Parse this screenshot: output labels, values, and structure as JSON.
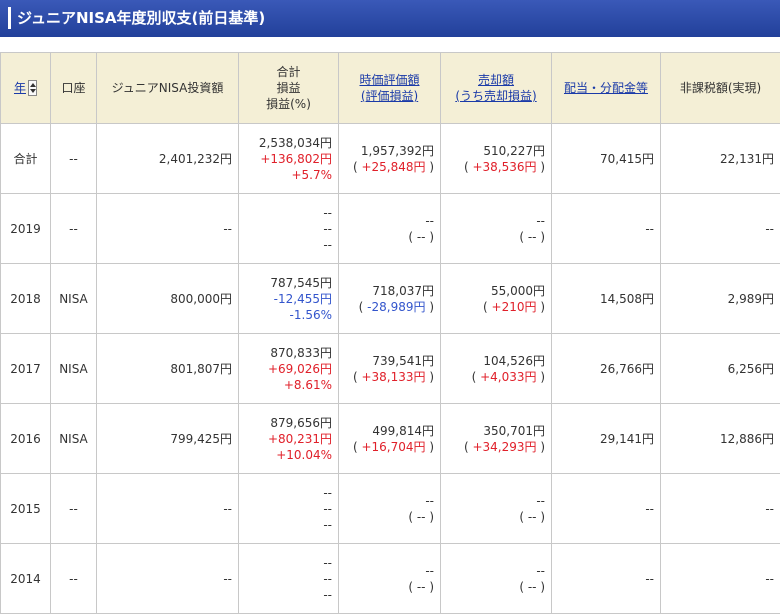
{
  "title": "ジュニアNISA年度別収支(前日基準)",
  "headers": {
    "year": "年",
    "account": "口座",
    "invest": "ジュニアNISA投資額",
    "total_l1": "合計",
    "total_l2": "損益",
    "total_l3": "損益(%)",
    "eval_l1": "時価評価額",
    "eval_l2": "(評価損益)",
    "sale_l1": "売却額",
    "sale_l2": "(うち売却損益)",
    "dividend": "配当・分配金等",
    "tax": "非課税額(実現)"
  },
  "rows": [
    {
      "year": "合計",
      "account": "--",
      "invest": "2,401,232円",
      "total": "2,538,034円",
      "pl": "+136,802円",
      "pct": "+5.7%",
      "eval": "1,957,392円",
      "eval_pl": "+25,848円",
      "sale": "510,227円",
      "sale_pl": "+38,536円",
      "dividend": "70,415円",
      "tax": "22,131円",
      "pl_sign": "pos",
      "eval_sign": "pos",
      "sale_sign": "pos"
    },
    {
      "year": "2019",
      "account": "--",
      "invest": "--",
      "total": "--",
      "pl": "--",
      "pct": "--",
      "eval": "--",
      "eval_pl": "--",
      "sale": "--",
      "sale_pl": "--",
      "dividend": "--",
      "tax": "--",
      "pl_sign": "none",
      "eval_sign": "none",
      "sale_sign": "none"
    },
    {
      "year": "2018",
      "account": "NISA",
      "invest": "800,000円",
      "total": "787,545円",
      "pl": "-12,455円",
      "pct": "-1.56%",
      "eval": "718,037円",
      "eval_pl": "-28,989円",
      "sale": "55,000円",
      "sale_pl": "+210円",
      "dividend": "14,508円",
      "tax": "2,989円",
      "pl_sign": "neg",
      "eval_sign": "neg",
      "sale_sign": "pos"
    },
    {
      "year": "2017",
      "account": "NISA",
      "invest": "801,807円",
      "total": "870,833円",
      "pl": "+69,026円",
      "pct": "+8.61%",
      "eval": "739,541円",
      "eval_pl": "+38,133円",
      "sale": "104,526円",
      "sale_pl": "+4,033円",
      "dividend": "26,766円",
      "tax": "6,256円",
      "pl_sign": "pos",
      "eval_sign": "pos",
      "sale_sign": "pos"
    },
    {
      "year": "2016",
      "account": "NISA",
      "invest": "799,425円",
      "total": "879,656円",
      "pl": "+80,231円",
      "pct": "+10.04%",
      "eval": "499,814円",
      "eval_pl": "+16,704円",
      "sale": "350,701円",
      "sale_pl": "+34,293円",
      "dividend": "29,141円",
      "tax": "12,886円",
      "pl_sign": "pos",
      "eval_sign": "pos",
      "sale_sign": "pos"
    },
    {
      "year": "2015",
      "account": "--",
      "invest": "--",
      "total": "--",
      "pl": "--",
      "pct": "--",
      "eval": "--",
      "eval_pl": "--",
      "sale": "--",
      "sale_pl": "--",
      "dividend": "--",
      "tax": "--",
      "pl_sign": "none",
      "eval_sign": "none",
      "sale_sign": "none"
    },
    {
      "year": "2014",
      "account": "--",
      "invest": "--",
      "total": "--",
      "pl": "--",
      "pct": "--",
      "eval": "--",
      "eval_pl": "--",
      "sale": "--",
      "sale_pl": "--",
      "dividend": "--",
      "tax": "--",
      "pl_sign": "none",
      "eval_sign": "none",
      "sale_sign": "none"
    }
  ],
  "colors": {
    "positive": "#e0202a",
    "negative": "#3355cc",
    "header_bg": "#f4efd6",
    "title_bg": "#2c4aa8",
    "link": "#1a3aa8"
  },
  "icons": {
    "sort": "sort-updown-icon"
  }
}
